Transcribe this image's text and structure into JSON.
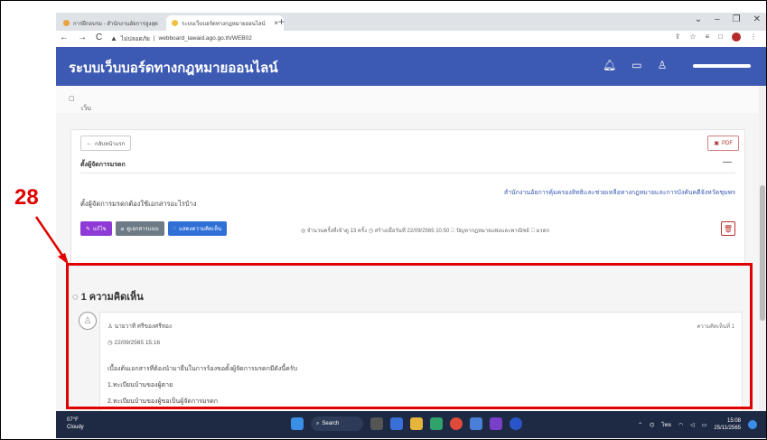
{
  "browser": {
    "tabs": [
      {
        "label": "การฝึกอบรม - สำนักงานอัยการสูงสุด"
      },
      {
        "label": "ระบบเว็บบอร์ดทางกฎหมายออนไลน์"
      }
    ],
    "url_prefix": "ไม่ปลอดภัย",
    "url": "webboard_lawaid.ago.go.th/WEB02"
  },
  "app": {
    "title": "ระบบเว็บบอร์ดทางกฎหมายออนไลน์",
    "breadcrumb": "เว็บบอร์ด"
  },
  "card": {
    "back_label": "กลับหน้าแรก",
    "pdf_label": "PDF",
    "title": "ตั้งผู้จัดการมรดก",
    "collapse": "—",
    "organization": "สำนักงานอัยการคุ้มครองสิทธิและช่วยเหลือทางกฎหมายและการบังคับคดีจังหวัดชุมพร",
    "question": "ตั้งผู้จัดการมรดกต้องใช้เอกสารอะไรบ้าง",
    "actions": {
      "edit": "แก้ไข",
      "attachments": "ดูเอกสารแนบ",
      "comment": "แสดงความคิดเห็น"
    },
    "meta": "◎ จำนวนครั้งที่เข้าดู 13 ครั้ง ◷ สร้างเมื่อวันที่ 22/09/2565 10:50 ⃟ ปัญหากฎหมายแพ่งและพาณิชย์ ⃟ มรดก"
  },
  "comments": {
    "heading": "1 ความคิดเห็น",
    "items": [
      {
        "user": "นายวาที ศรีของศรีทอง",
        "date": "22/09/2565 15:16",
        "number": "ความคิดเห็นที่ 1",
        "lines": [
          "เบื้องต้นเอกสารที่ต้องนำมายื่นในการร้องขอตั้งผู้จัดการมรดกมีดังนี้ครับ",
          "1.ทะเบียนบ้านของผู้ตาย",
          "2.ทะเบียนบ้านของผู้ขอเป็นผู้จัดการมรดก"
        ]
      }
    ]
  },
  "taskbar": {
    "weather_temp": "07°F",
    "weather_text": "Cloudy",
    "search": "Search",
    "lang": "ไทย",
    "time": "15:08",
    "date": "25/11/2565"
  },
  "annotation": {
    "label": "28",
    "color": "#e00000"
  }
}
